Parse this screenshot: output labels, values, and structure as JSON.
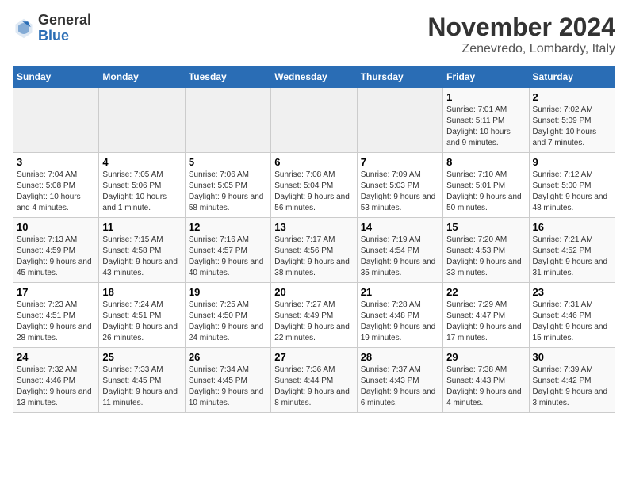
{
  "header": {
    "logo_general": "General",
    "logo_blue": "Blue",
    "month_title": "November 2024",
    "location": "Zenevredo, Lombardy, Italy"
  },
  "days_of_week": [
    "Sunday",
    "Monday",
    "Tuesday",
    "Wednesday",
    "Thursday",
    "Friday",
    "Saturday"
  ],
  "weeks": [
    [
      {
        "day": "",
        "info": ""
      },
      {
        "day": "",
        "info": ""
      },
      {
        "day": "",
        "info": ""
      },
      {
        "day": "",
        "info": ""
      },
      {
        "day": "",
        "info": ""
      },
      {
        "day": "1",
        "info": "Sunrise: 7:01 AM\nSunset: 5:11 PM\nDaylight: 10 hours and 9 minutes."
      },
      {
        "day": "2",
        "info": "Sunrise: 7:02 AM\nSunset: 5:09 PM\nDaylight: 10 hours and 7 minutes."
      }
    ],
    [
      {
        "day": "3",
        "info": "Sunrise: 7:04 AM\nSunset: 5:08 PM\nDaylight: 10 hours and 4 minutes."
      },
      {
        "day": "4",
        "info": "Sunrise: 7:05 AM\nSunset: 5:06 PM\nDaylight: 10 hours and 1 minute."
      },
      {
        "day": "5",
        "info": "Sunrise: 7:06 AM\nSunset: 5:05 PM\nDaylight: 9 hours and 58 minutes."
      },
      {
        "day": "6",
        "info": "Sunrise: 7:08 AM\nSunset: 5:04 PM\nDaylight: 9 hours and 56 minutes."
      },
      {
        "day": "7",
        "info": "Sunrise: 7:09 AM\nSunset: 5:03 PM\nDaylight: 9 hours and 53 minutes."
      },
      {
        "day": "8",
        "info": "Sunrise: 7:10 AM\nSunset: 5:01 PM\nDaylight: 9 hours and 50 minutes."
      },
      {
        "day": "9",
        "info": "Sunrise: 7:12 AM\nSunset: 5:00 PM\nDaylight: 9 hours and 48 minutes."
      }
    ],
    [
      {
        "day": "10",
        "info": "Sunrise: 7:13 AM\nSunset: 4:59 PM\nDaylight: 9 hours and 45 minutes."
      },
      {
        "day": "11",
        "info": "Sunrise: 7:15 AM\nSunset: 4:58 PM\nDaylight: 9 hours and 43 minutes."
      },
      {
        "day": "12",
        "info": "Sunrise: 7:16 AM\nSunset: 4:57 PM\nDaylight: 9 hours and 40 minutes."
      },
      {
        "day": "13",
        "info": "Sunrise: 7:17 AM\nSunset: 4:56 PM\nDaylight: 9 hours and 38 minutes."
      },
      {
        "day": "14",
        "info": "Sunrise: 7:19 AM\nSunset: 4:54 PM\nDaylight: 9 hours and 35 minutes."
      },
      {
        "day": "15",
        "info": "Sunrise: 7:20 AM\nSunset: 4:53 PM\nDaylight: 9 hours and 33 minutes."
      },
      {
        "day": "16",
        "info": "Sunrise: 7:21 AM\nSunset: 4:52 PM\nDaylight: 9 hours and 31 minutes."
      }
    ],
    [
      {
        "day": "17",
        "info": "Sunrise: 7:23 AM\nSunset: 4:51 PM\nDaylight: 9 hours and 28 minutes."
      },
      {
        "day": "18",
        "info": "Sunrise: 7:24 AM\nSunset: 4:51 PM\nDaylight: 9 hours and 26 minutes."
      },
      {
        "day": "19",
        "info": "Sunrise: 7:25 AM\nSunset: 4:50 PM\nDaylight: 9 hours and 24 minutes."
      },
      {
        "day": "20",
        "info": "Sunrise: 7:27 AM\nSunset: 4:49 PM\nDaylight: 9 hours and 22 minutes."
      },
      {
        "day": "21",
        "info": "Sunrise: 7:28 AM\nSunset: 4:48 PM\nDaylight: 9 hours and 19 minutes."
      },
      {
        "day": "22",
        "info": "Sunrise: 7:29 AM\nSunset: 4:47 PM\nDaylight: 9 hours and 17 minutes."
      },
      {
        "day": "23",
        "info": "Sunrise: 7:31 AM\nSunset: 4:46 PM\nDaylight: 9 hours and 15 minutes."
      }
    ],
    [
      {
        "day": "24",
        "info": "Sunrise: 7:32 AM\nSunset: 4:46 PM\nDaylight: 9 hours and 13 minutes."
      },
      {
        "day": "25",
        "info": "Sunrise: 7:33 AM\nSunset: 4:45 PM\nDaylight: 9 hours and 11 minutes."
      },
      {
        "day": "26",
        "info": "Sunrise: 7:34 AM\nSunset: 4:45 PM\nDaylight: 9 hours and 10 minutes."
      },
      {
        "day": "27",
        "info": "Sunrise: 7:36 AM\nSunset: 4:44 PM\nDaylight: 9 hours and 8 minutes."
      },
      {
        "day": "28",
        "info": "Sunrise: 7:37 AM\nSunset: 4:43 PM\nDaylight: 9 hours and 6 minutes."
      },
      {
        "day": "29",
        "info": "Sunrise: 7:38 AM\nSunset: 4:43 PM\nDaylight: 9 hours and 4 minutes."
      },
      {
        "day": "30",
        "info": "Sunrise: 7:39 AM\nSunset: 4:42 PM\nDaylight: 9 hours and 3 minutes."
      }
    ]
  ]
}
